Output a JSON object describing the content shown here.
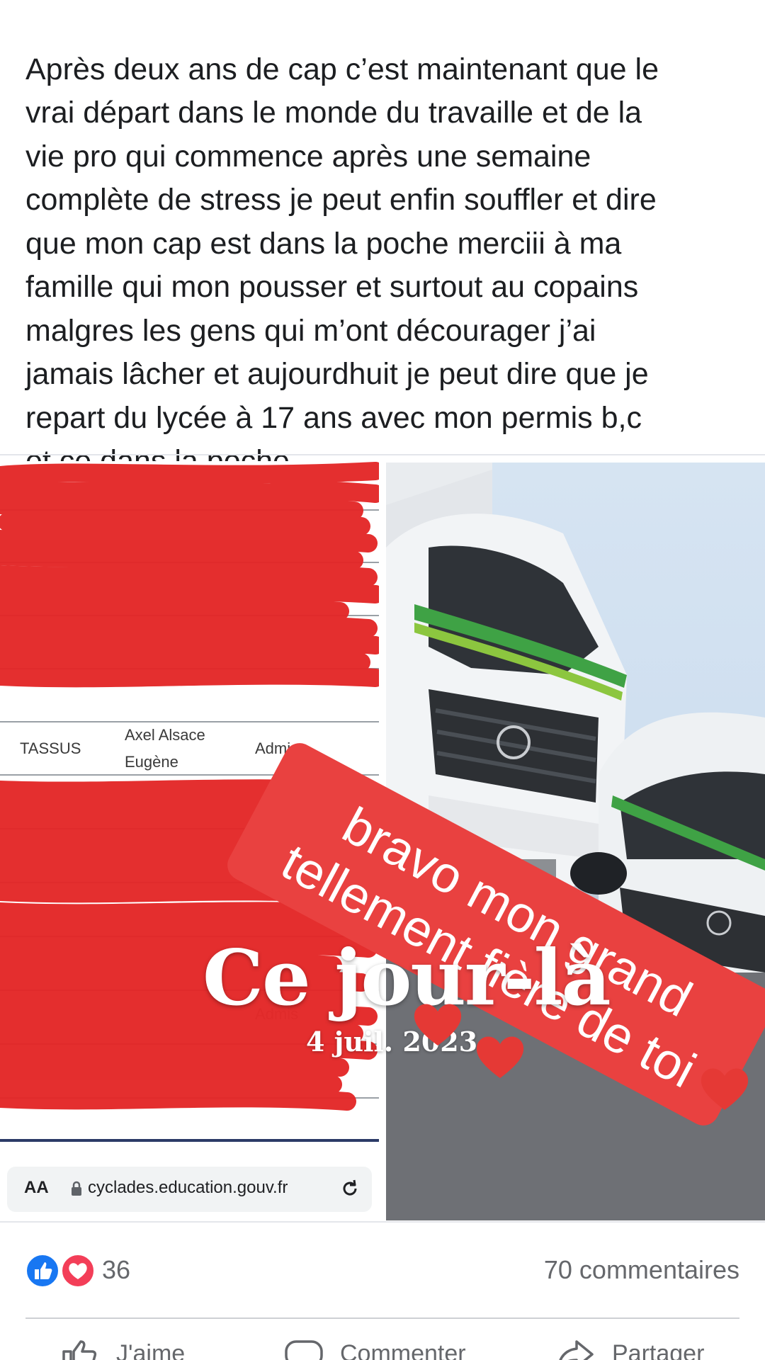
{
  "post": {
    "text": "Après deux ans de cap c’est maintenant que le\nvrai départ dans le monde du travaille et de la\nvie pro qui commence après une semaine\ncomplète de stress je peut enfin souffler et dire\nque mon cap est dans la poche merciii à ma\nfamille qui mon pousser et surtout au copains\nmalgres les gens qui m’ont décourager j’ai\njamais lâcher et aujourdhuit je peut dire que je\nrepart du lycée à 17 ans avec mon permis b,c\net ce dans la poche",
    "emojis": [
      "truck-icon",
      "champagne-icon",
      "heart-hands-icon"
    ]
  },
  "results_screenshot": {
    "visible_row": {
      "surname": "TASSUS",
      "firstnames_line1": "Axel Alsace",
      "firstnames_line2": "Eugène",
      "status": "Admis"
    },
    "admis_partial": "Admis",
    "browser": {
      "aa_label": "AA",
      "url": "cyclades.education.gouv.fr"
    }
  },
  "overlay": {
    "sticker_line1": "bravo mon grand",
    "sticker_line2": "tellement fière de toi",
    "memory_title": "Ce jour-là",
    "memory_date": "4 juil. 2023"
  },
  "reactions": {
    "count": "36",
    "comments": "70 commentaires",
    "like_color": "#1877f2",
    "love_color": "#f33e58"
  },
  "actions": {
    "like": "J'aime",
    "comment": "Commenter",
    "share": "Partager"
  },
  "colors": {
    "scribble_red": "#e32626",
    "sticker_red": "#e94140"
  }
}
